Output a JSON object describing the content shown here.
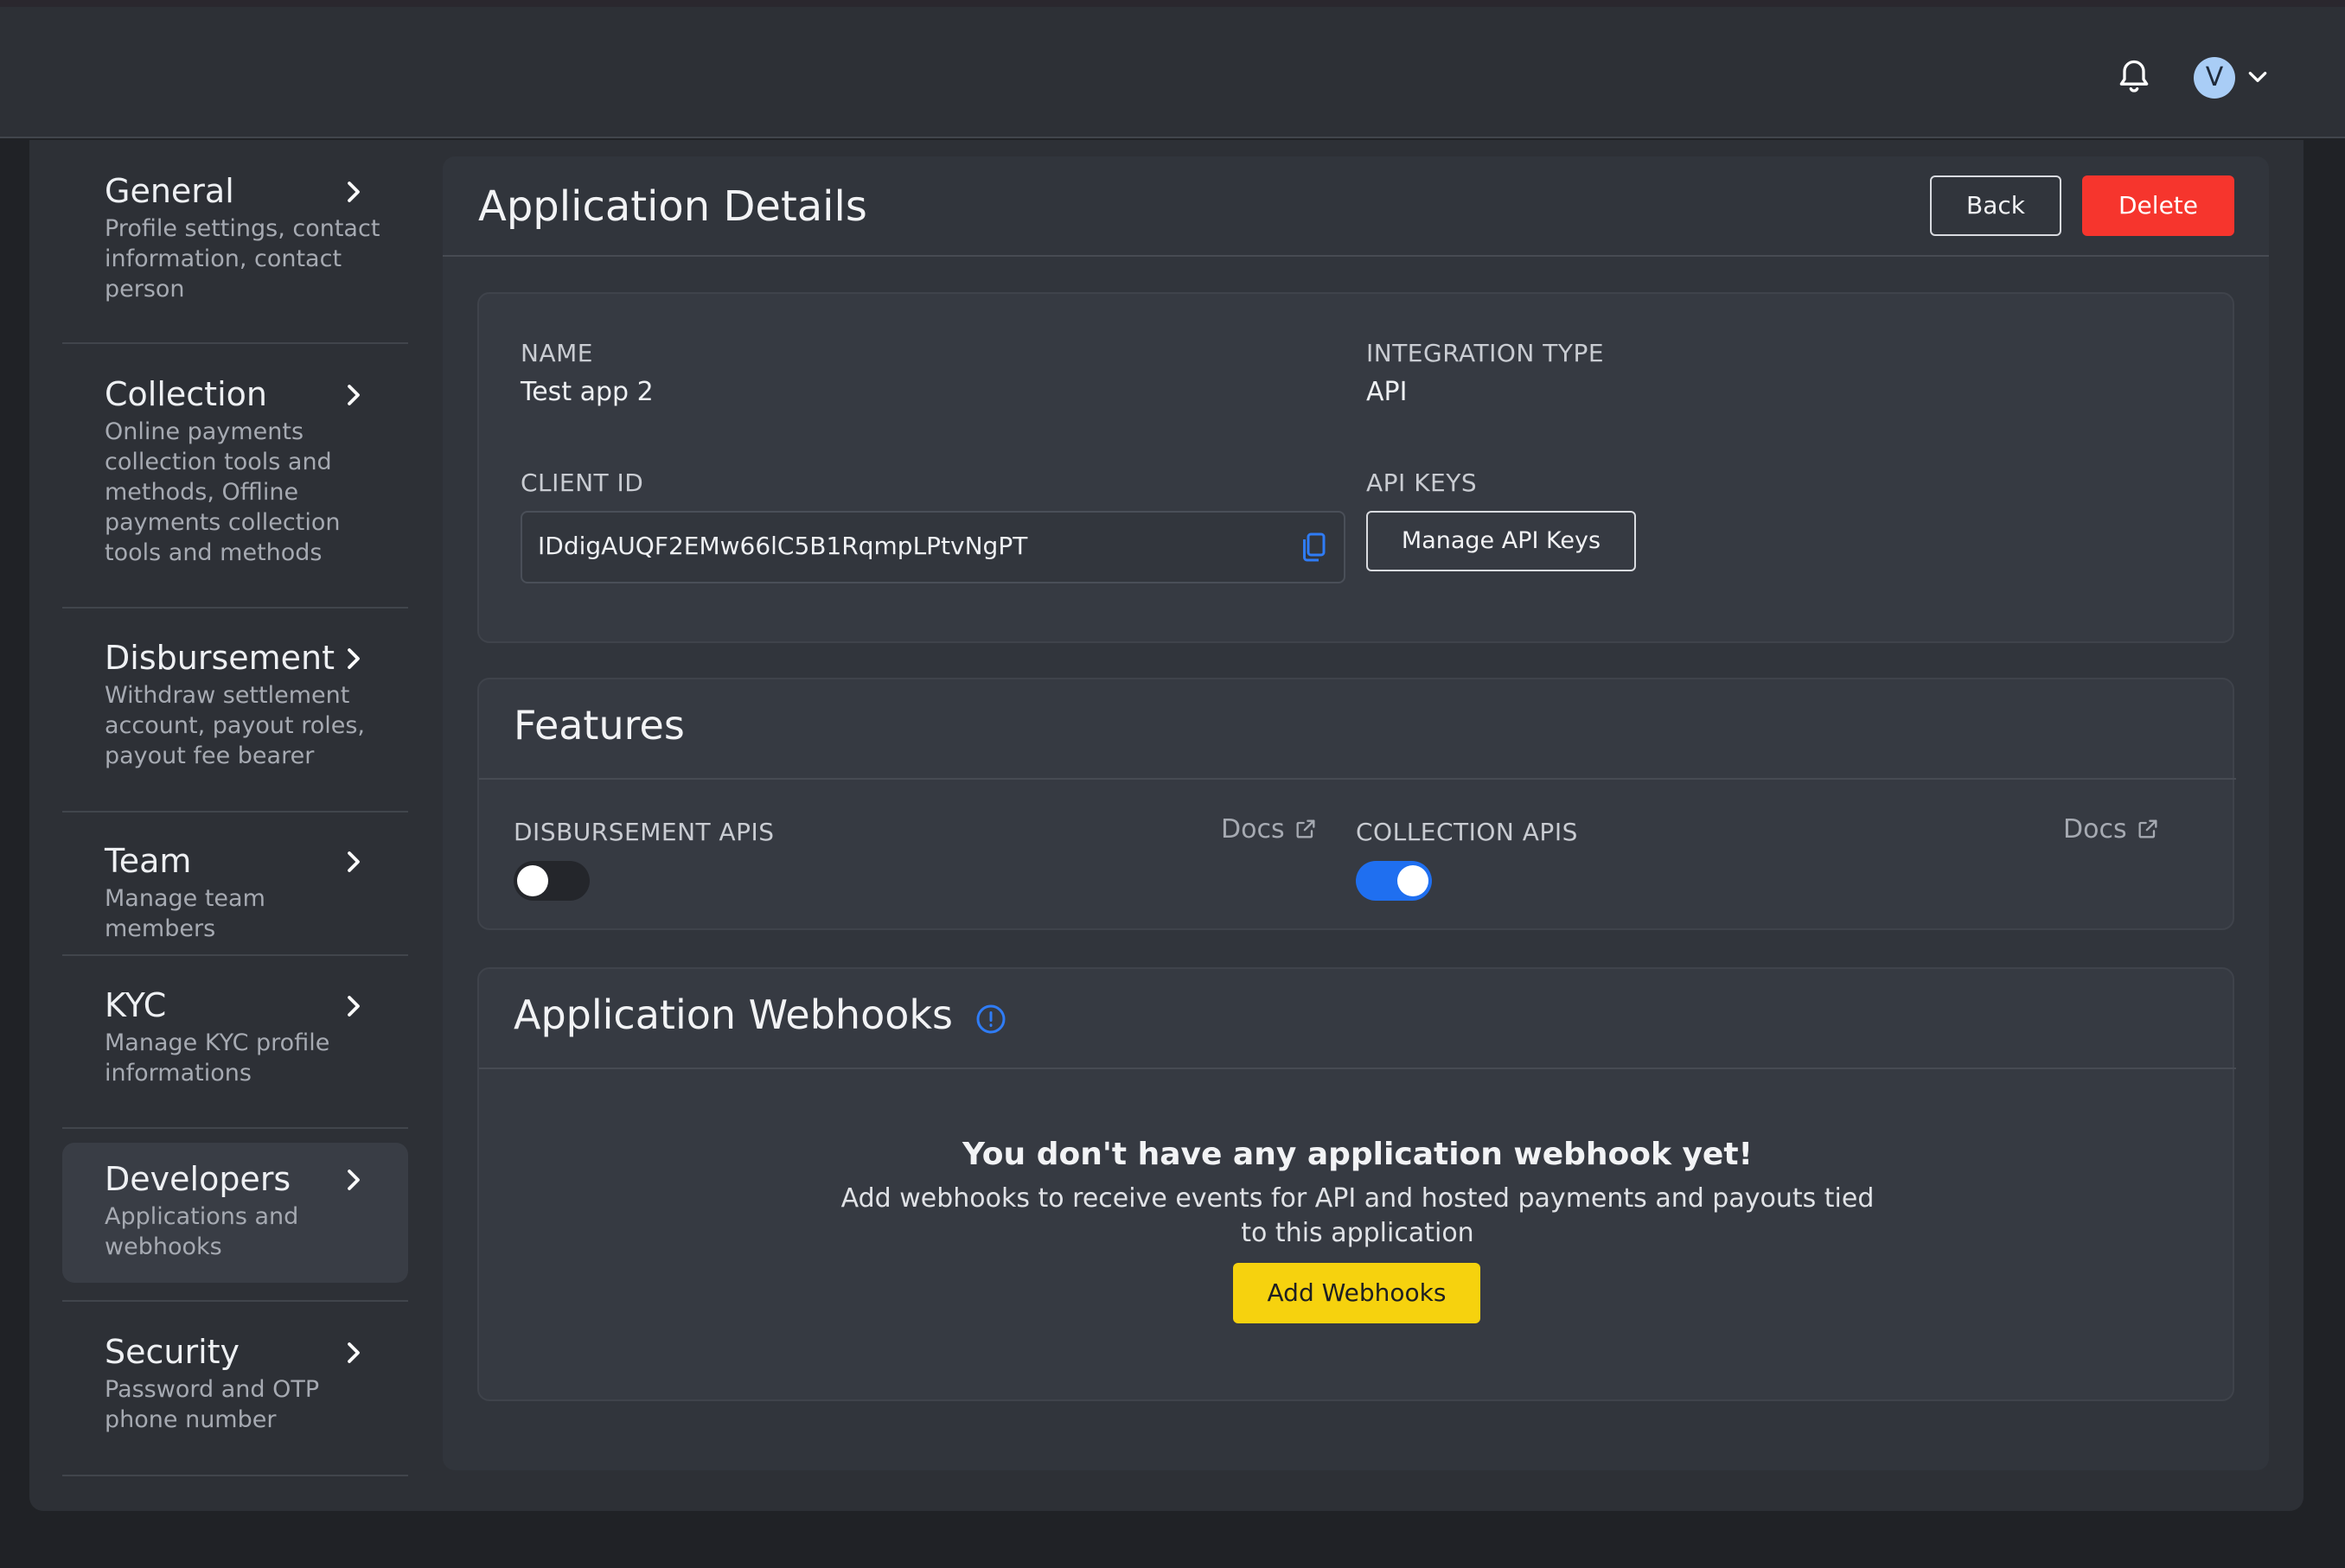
{
  "header": {
    "avatar_initial": "V"
  },
  "sidebar": {
    "items": [
      {
        "title": "General",
        "desc": "Profile settings, contact information, contact person"
      },
      {
        "title": "Collection",
        "desc": "Online payments collection tools and methods, Offline payments collection tools and methods"
      },
      {
        "title": "Disbursement",
        "desc": "Withdraw settlement account, payout roles, payout fee bearer"
      },
      {
        "title": "Team",
        "desc": "Manage team members"
      },
      {
        "title": "KYC",
        "desc": "Manage KYC profile informations"
      },
      {
        "title": "Developers",
        "desc": "Applications and webhooks",
        "active": true
      },
      {
        "title": "Security",
        "desc": "Password and OTP phone number"
      }
    ]
  },
  "main": {
    "title": "Application Details",
    "back_label": "Back",
    "delete_label": "Delete",
    "details": {
      "name_label": "NAME",
      "name_value": "Test app 2",
      "integration_label": "INTEGRATION TYPE",
      "integration_value": "API",
      "client_id_label": "CLIENT ID",
      "client_id_value": "IDdigAUQF2EMw66lC5B1RqmpLPtvNgPT",
      "api_keys_label": "API KEYS",
      "manage_keys_label": "Manage API Keys"
    },
    "features": {
      "title": "Features",
      "disbursement_label": "DISBURSEMENT APIS",
      "disbursement_enabled": false,
      "collection_label": "COLLECTION APIS",
      "collection_enabled": true,
      "docs_label": "Docs"
    },
    "webhooks": {
      "title": "Application Webhooks",
      "empty_title": "You don't have any application webhook yet!",
      "empty_desc": "Add webhooks to receive events for API and hosted payments and payouts tied to this application",
      "add_label": "Add Webhooks"
    }
  },
  "colors": {
    "accent_blue": "#1f6ff0",
    "danger": "#f6352d",
    "cta_yellow": "#f6d20e",
    "background": "#2d3036"
  }
}
